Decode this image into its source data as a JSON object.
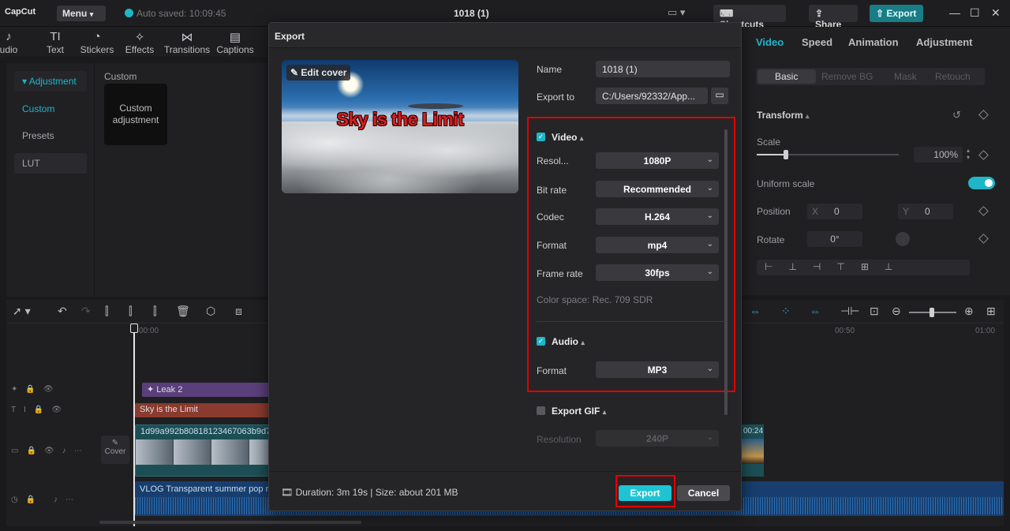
{
  "app": {
    "logo": "CapCut",
    "menu_label": "Menu",
    "autosave": "Auto saved: 10:09:45",
    "project_title": "1018 (1)",
    "shortcuts_label": "Shortcuts",
    "share_label": "Share",
    "export_label": "Export"
  },
  "toolbar": {
    "items": [
      {
        "label": "udio",
        "icon": "audio-icon"
      },
      {
        "label": "Text",
        "icon": "text-icon"
      },
      {
        "label": "Stickers",
        "icon": "stickers-icon"
      },
      {
        "label": "Effects",
        "icon": "effects-icon"
      },
      {
        "label": "Transitions",
        "icon": "transitions-icon"
      },
      {
        "label": "Captions",
        "icon": "captions-icon"
      }
    ]
  },
  "left_panel": {
    "section": "Adjustment",
    "items": [
      "Custom",
      "Presets",
      "LUT"
    ],
    "custom_title": "Custom",
    "card_label": "Custom adjustment"
  },
  "right_panel": {
    "tabs": [
      "Video",
      "Speed",
      "Animation",
      "Adjustment"
    ],
    "subtabs": [
      "Basic",
      "Remove BG",
      "Mask",
      "Retouch"
    ],
    "transform_label": "Transform",
    "scale_label": "Scale",
    "scale_value": "100%",
    "uniform_scale_label": "Uniform scale",
    "position_label": "Position",
    "pos_x_label": "X",
    "pos_x": "0",
    "pos_y_label": "Y",
    "pos_y": "0",
    "rotate_label": "Rotate",
    "rotate_value": "0°"
  },
  "timeline": {
    "time_start": "00:00",
    "time_mid": "00:50",
    "time_end": "01:00",
    "clips": {
      "effect": "Leak 2",
      "text": "Sky is the Limit",
      "video": "1d99a992b80818123467063b9d74",
      "video_time": "00:24",
      "audio": "VLOG Transparent summer pop mu",
      "cover_label": "Cover"
    }
  },
  "dialog": {
    "title": "Export",
    "edit_cover_label": "Edit cover",
    "cover_text": "Sky is the Limit",
    "name_label": "Name",
    "name_value": "1018 (1)",
    "export_to_label": "Export to",
    "export_to_value": "C:/Users/92332/App...",
    "video": {
      "title": "Video",
      "resolution_label": "Resol...",
      "resolution_value": "1080P",
      "bitrate_label": "Bit rate",
      "bitrate_value": "Recommended",
      "codec_label": "Codec",
      "codec_value": "H.264",
      "format_label": "Format",
      "format_value": "mp4",
      "framerate_label": "Frame rate",
      "framerate_value": "30fps",
      "colorspace": "Color space: Rec. 709 SDR"
    },
    "audio": {
      "title": "Audio",
      "format_label": "Format",
      "format_value": "MP3"
    },
    "gif": {
      "title": "Export GIF",
      "resolution_label": "Resolution",
      "resolution_value": "240P"
    },
    "footer_info": "Duration: 3m 19s | Size: about 201 MB",
    "export_button": "Export",
    "cancel_button": "Cancel"
  },
  "colors": {
    "accent": "#1fb6c7",
    "highlight": "#e10000"
  }
}
